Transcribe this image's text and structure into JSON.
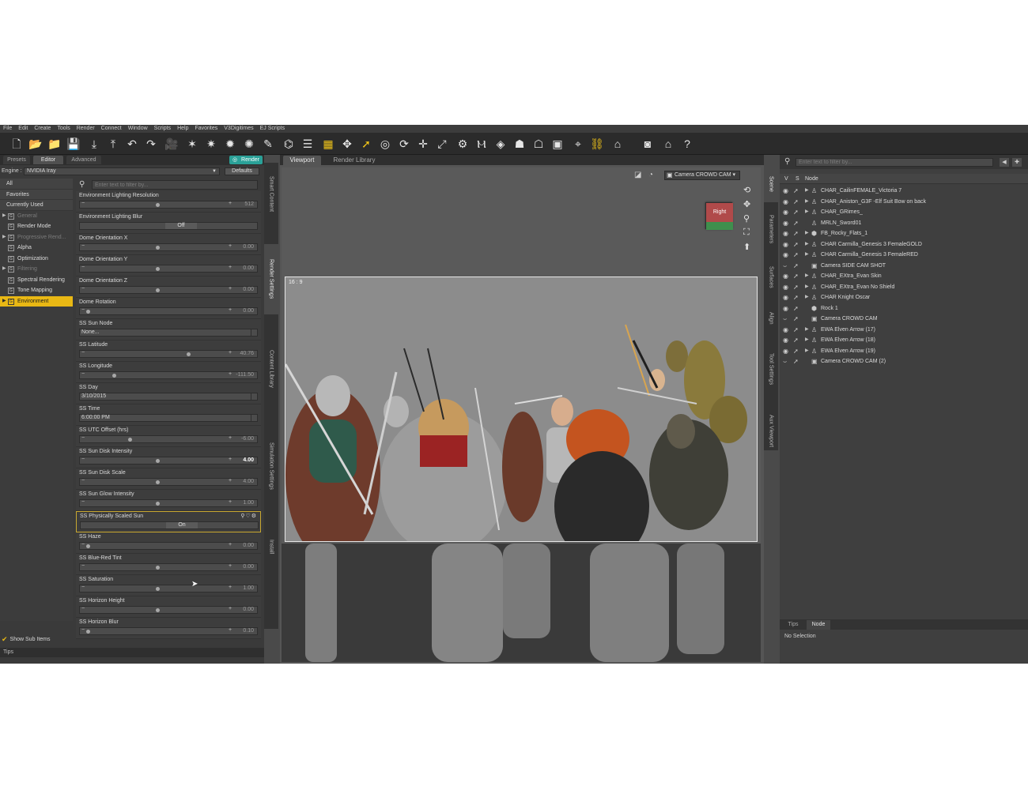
{
  "menu": [
    "File",
    "Edit",
    "Create",
    "Tools",
    "Render",
    "Connect",
    "Window",
    "Scripts",
    "Help",
    "Favorites",
    "V3Digitimes",
    "EJ Scripts"
  ],
  "toolbar_icons": [
    "new-file-icon",
    "open-icon",
    "merge-icon",
    "save-icon",
    "import-icon",
    "export-icon",
    "undo-icon",
    "redo-icon",
    "scene-camera-icon",
    "spotlight-icon",
    "distant-light-icon",
    "point-light-icon",
    "light-tool-icon",
    "paint-icon",
    "joint-editor-icon",
    "list-icon",
    "region-nav-icon",
    "universal-tool-icon",
    "select-arrow-icon",
    "node-select-icon",
    "rotate-icon",
    "translate-icon",
    "scale-icon",
    "pose-tool-icon",
    "figure-tool-icon",
    "geometry-icon",
    "morph-icon",
    "shaping-icon",
    "camera-icon",
    "smart-icon",
    "lock-icon",
    "preview-icon",
    "screenshot-icon",
    "daz-store-icon",
    "whats-this-icon",
    "help-icon"
  ],
  "left_panel": {
    "tabs": [
      "Presets",
      "Editor",
      "Advanced"
    ],
    "active_tab": "Editor",
    "render_button": "Render",
    "engine_label": "Engine :",
    "engine_value": "NVIDIA Iray",
    "defaults_button": "Defaults",
    "filter_placeholder": "Enter text to filter by...",
    "show_sub_items": "Show Sub Items",
    "tips": "Tips",
    "groups": [
      {
        "label": "All",
        "kind": "plain"
      },
      {
        "label": "Favorites",
        "kind": "plain"
      },
      {
        "label": "Currently Used",
        "kind": "plain"
      },
      {
        "label": "General",
        "kind": "dim",
        "expand": "▶"
      },
      {
        "label": "Render Mode",
        "kind": "normal",
        "expand": ""
      },
      {
        "label": "Progressive Rend...",
        "kind": "dim",
        "expand": "▶"
      },
      {
        "label": "Alpha",
        "kind": "normal",
        "expand": ""
      },
      {
        "label": "Optimization",
        "kind": "normal",
        "expand": ""
      },
      {
        "label": "Filtering",
        "kind": "dim",
        "expand": "▶"
      },
      {
        "label": "Spectral Rendering",
        "kind": "normal",
        "expand": ""
      },
      {
        "label": "Tone Mapping",
        "kind": "normal",
        "expand": ""
      },
      {
        "label": "Environment",
        "kind": "selected",
        "expand": "▶"
      }
    ],
    "properties": [
      {
        "label": "Environment Lighting Resolution",
        "type": "slider",
        "value": "512",
        "level": 0.5
      },
      {
        "label": "Environment Lighting Blur",
        "type": "toggle",
        "value": "Off"
      },
      {
        "label": "Dome Orientation X",
        "type": "slider",
        "value": "0.00",
        "level": 0.5
      },
      {
        "label": "Dome Orientation Y",
        "type": "slider",
        "value": "0.00",
        "level": 0.5
      },
      {
        "label": "Dome Orientation Z",
        "type": "slider",
        "value": "0.00",
        "level": 0.5
      },
      {
        "label": "Dome Rotation",
        "type": "slider",
        "value": "0.00",
        "level": 0.0
      },
      {
        "label": "SS Sun Node",
        "type": "text",
        "value": "None..."
      },
      {
        "label": "SS Latitude",
        "type": "slider",
        "value": "40.76",
        "level": 0.72
      },
      {
        "label": "SS Longitude",
        "type": "slider",
        "value": "-111.50",
        "level": 0.19
      },
      {
        "label": "SS Day",
        "type": "text",
        "value": "3/10/2015"
      },
      {
        "label": "SS Time",
        "type": "text",
        "value": "6:00:00 PM"
      },
      {
        "label": "SS UTC Offset (hrs)",
        "type": "slider",
        "value": "-6.00",
        "level": 0.3
      },
      {
        "label": "SS Sun Disk Intensity",
        "type": "slider",
        "value": "4.00",
        "level": 0.5,
        "bright": true
      },
      {
        "label": "SS Sun Disk Scale",
        "type": "slider",
        "value": "4.00",
        "level": 0.5
      },
      {
        "label": "SS Sun Glow Intensity",
        "type": "slider",
        "value": "1.00",
        "level": 0.5
      },
      {
        "label": "SS Physically Scaled Sun",
        "type": "toggle",
        "value": "On",
        "highlight": true
      },
      {
        "label": "SS Haze",
        "type": "slider",
        "value": "0.00",
        "level": 0.0
      },
      {
        "label": "SS Blue-Red Tint",
        "type": "slider",
        "value": "0.00",
        "level": 0.5
      },
      {
        "label": "SS Saturation",
        "type": "slider",
        "value": "1.00",
        "level": 0.5
      },
      {
        "label": "SS Horizon Height",
        "type": "slider",
        "value": "0.00",
        "level": 0.5
      },
      {
        "label": "SS Horizon Blur",
        "type": "slider",
        "value": "0.10",
        "level": 0.0
      }
    ]
  },
  "left_side_tabs": [
    "Smart Content",
    "Render Settings",
    "Content Library",
    "Simulation Settings",
    "Install"
  ],
  "left_side_active": "Render Settings",
  "viewport": {
    "tabs": [
      "Viewport",
      "Render Library"
    ],
    "active_tab": "Viewport",
    "camera": "Camera CROWD CAM",
    "aspect": "16 : 9",
    "view_cube_label": "Right"
  },
  "right_side_tabs": [
    "Scene",
    "Parameters",
    "Surfaces",
    "Align",
    "Tool Settings",
    "Aux Viewport"
  ],
  "right_side_active": "Scene",
  "scene": {
    "filter_placeholder": "Enter text to filter by...",
    "columns": {
      "v": "V",
      "s": "S",
      "node": "Node"
    },
    "nodes": [
      {
        "name": "CHAR_CailinFEMALE_Victoria 7",
        "icon": "figure",
        "expand": true
      },
      {
        "name": "CHAR_Aniston_G3F -Elf Suit Bow on back",
        "icon": "figure",
        "expand": true
      },
      {
        "name": "CHAR_GRimes_",
        "icon": "figure",
        "expand": true
      },
      {
        "name": "MRLN_Sword01",
        "icon": "figure",
        "expand": false
      },
      {
        "name": "FB_Rocky_Flats_1",
        "icon": "prop",
        "expand": true
      },
      {
        "name": "CHAR Carmilla_Genesis 3 FemaleGOLD",
        "icon": "figure",
        "expand": true
      },
      {
        "name": "CHAR Carmilla_Genesis 3 FemaleRED",
        "icon": "figure",
        "expand": true
      },
      {
        "name": "Camera SIDE CAM SHOT",
        "icon": "camera",
        "expand": false
      },
      {
        "name": "CHAR_EXtra_Evan Skin",
        "icon": "figure",
        "expand": true
      },
      {
        "name": "CHAR_EXtra_Evan No Shield",
        "icon": "figure",
        "expand": true
      },
      {
        "name": "CHAR Knight Oscar",
        "icon": "figure",
        "expand": true
      },
      {
        "name": "Rock 1",
        "icon": "prop",
        "expand": false
      },
      {
        "name": "Camera CROWD CAM",
        "icon": "camera",
        "expand": false
      },
      {
        "name": "EWA Elven Arrow (17)",
        "icon": "figure",
        "expand": true
      },
      {
        "name": "EWA Elven Arrow (18)",
        "icon": "figure",
        "expand": true
      },
      {
        "name": "EWA Elven Arrow (19)",
        "icon": "figure",
        "expand": true
      },
      {
        "name": "Camera CROWD CAM (2)",
        "icon": "camera",
        "expand": false
      }
    ],
    "bottom_tabs": [
      "Tips",
      "Node"
    ],
    "active_bottom_tab": "Node",
    "status": "No Selection"
  },
  "colors": {
    "accent": "#e9b814",
    "render_button": "#2aa198",
    "panel": "#3a3a3a"
  }
}
